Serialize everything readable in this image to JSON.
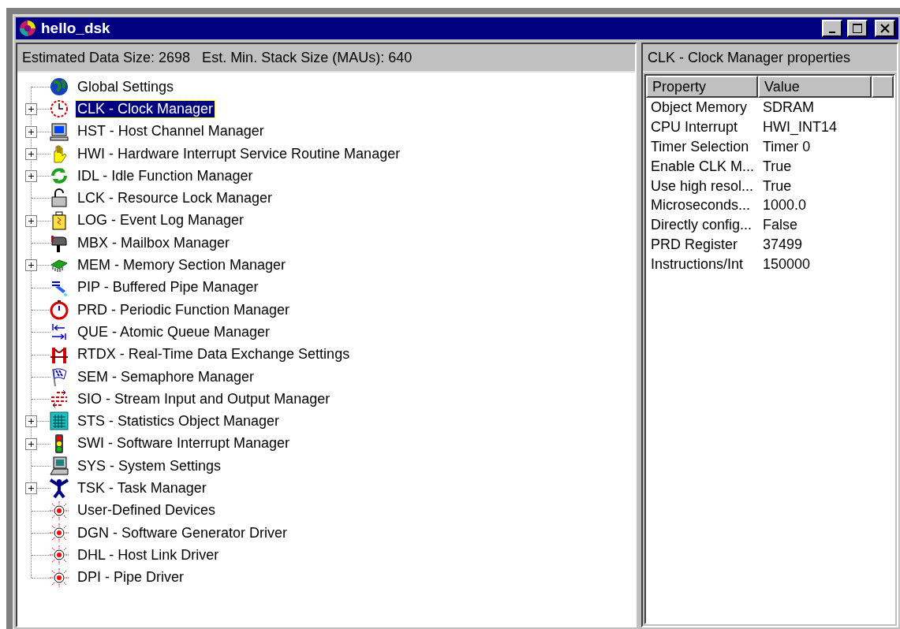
{
  "window": {
    "title": "hello_dsk"
  },
  "tree_header": {
    "text": "Estimated Data Size: 2698   Est. Min. Stack Size (MAUs): 640"
  },
  "tree": [
    {
      "label": "Global Settings",
      "kind": "globe",
      "expandable": false,
      "selected": false
    },
    {
      "label": "CLK - Clock Manager",
      "kind": "clock",
      "expandable": true,
      "selected": true
    },
    {
      "label": "HST - Host Channel Manager",
      "kind": "monitor",
      "expandable": true,
      "selected": false
    },
    {
      "label": "HWI - Hardware Interrupt Service Routine Manager",
      "kind": "hand",
      "expandable": true,
      "selected": false
    },
    {
      "label": "IDL - Idle Function Manager",
      "kind": "cycle",
      "expandable": true,
      "selected": false
    },
    {
      "label": "LCK - Resource Lock Manager",
      "kind": "lock",
      "expandable": false,
      "selected": false
    },
    {
      "label": "LOG - Event Log Manager",
      "kind": "jar",
      "expandable": true,
      "selected": false
    },
    {
      "label": "MBX - Mailbox Manager",
      "kind": "mailbox",
      "expandable": false,
      "selected": false
    },
    {
      "label": "MEM - Memory Section Manager",
      "kind": "chip",
      "expandable": true,
      "selected": false
    },
    {
      "label": "PIP - Buffered Pipe Manager",
      "kind": "pipe",
      "expandable": false,
      "selected": false
    },
    {
      "label": "PRD - Periodic Function Manager",
      "kind": "stopwatch",
      "expandable": false,
      "selected": false
    },
    {
      "label": "QUE - Atomic Queue Manager",
      "kind": "queue",
      "expandable": false,
      "selected": false
    },
    {
      "label": "RTDX - Real-Time Data Exchange Settings",
      "kind": "bridge",
      "expandable": false,
      "selected": false
    },
    {
      "label": "SEM - Semaphore Manager",
      "kind": "flag",
      "expandable": false,
      "selected": false
    },
    {
      "label": "SIO - Stream Input and Output Manager",
      "kind": "stream",
      "expandable": false,
      "selected": false
    },
    {
      "label": "STS - Statistics Object Manager",
      "kind": "calculator",
      "expandable": true,
      "selected": false
    },
    {
      "label": "SWI - Software Interrupt Manager",
      "kind": "traffic",
      "expandable": true,
      "selected": false
    },
    {
      "label": "SYS - System Settings",
      "kind": "computer",
      "expandable": false,
      "selected": false
    },
    {
      "label": "TSK - Task Manager",
      "kind": "person",
      "expandable": true,
      "selected": false
    },
    {
      "label": "User-Defined Devices",
      "kind": "device",
      "expandable": false,
      "selected": false
    },
    {
      "label": "DGN - Software Generator Driver",
      "kind": "device",
      "expandable": false,
      "selected": false
    },
    {
      "label": "DHL - Host Link Driver",
      "kind": "device",
      "expandable": false,
      "selected": false
    },
    {
      "label": "DPI - Pipe Driver",
      "kind": "device",
      "expandable": false,
      "selected": false
    }
  ],
  "properties_panel": {
    "title": "CLK - Clock Manager properties",
    "columns": [
      "Property",
      "Value"
    ],
    "rows": [
      {
        "property": "Object Memory",
        "value": "SDRAM"
      },
      {
        "property": "CPU Interrupt",
        "value": "HWI_INT14"
      },
      {
        "property": "Timer Selection",
        "value": "Timer 0"
      },
      {
        "property": "Enable CLK M...",
        "value": "True"
      },
      {
        "property": "Use high resol...",
        "value": "True"
      },
      {
        "property": "Microseconds...",
        "value": "1000.0"
      },
      {
        "property": "Directly config...",
        "value": "False"
      },
      {
        "property": "PRD Register",
        "value": "37499"
      },
      {
        "property": "Instructions/Int",
        "value": "150000"
      }
    ]
  }
}
